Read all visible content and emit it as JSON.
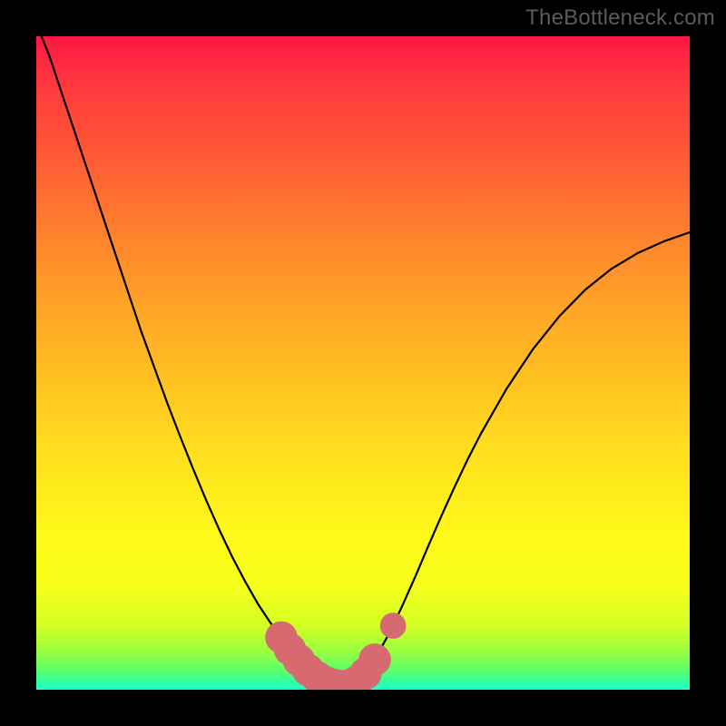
{
  "watermark": "TheBottleneck.com",
  "colors": {
    "curve": "#000000",
    "marker": "#d76a70",
    "marker_stroke": "#d76a70"
  },
  "chart_data": {
    "type": "line",
    "title": "",
    "xlabel": "",
    "ylabel": "",
    "xlim": [
      0,
      100
    ],
    "ylim": [
      0,
      100
    ],
    "grid": false,
    "legend": false,
    "series": [
      {
        "name": "bottleneck-curve",
        "x": [
          0,
          2,
          4,
          6,
          8,
          10,
          12,
          14,
          16,
          18,
          20,
          22,
          24,
          26,
          28,
          30,
          32,
          34,
          36,
          38,
          40,
          42,
          44,
          46,
          47,
          48,
          49,
          50,
          52,
          54,
          56,
          58,
          60,
          62,
          64,
          66,
          68,
          72,
          76,
          80,
          84,
          88,
          92,
          96,
          100
        ],
        "y": [
          102,
          97,
          91,
          85,
          79,
          73,
          67,
          61,
          55,
          49.5,
          44,
          38.8,
          33.8,
          29,
          24.5,
          20.3,
          16.5,
          13,
          10,
          7.4,
          5.2,
          3.4,
          2,
          1,
          0.6,
          0.6,
          1.1,
          2.2,
          5,
          8.6,
          12.8,
          17.3,
          22,
          26.6,
          31,
          35.2,
          39.1,
          46.1,
          52.1,
          57.1,
          61.2,
          64.4,
          66.8,
          68.6,
          70
        ]
      }
    ],
    "marker_cluster": {
      "description": "highlighted segment near curve minimum",
      "points": [
        {
          "x": 37.5,
          "y": 8.0,
          "r": 1.6
        },
        {
          "x": 38.8,
          "y": 6.2,
          "r": 1.6
        },
        {
          "x": 40.2,
          "y": 4.5,
          "r": 1.6
        },
        {
          "x": 41.6,
          "y": 3.0,
          "r": 1.6
        },
        {
          "x": 43.0,
          "y": 1.9,
          "r": 1.6
        },
        {
          "x": 44.4,
          "y": 1.1,
          "r": 1.6
        },
        {
          "x": 45.8,
          "y": 0.7,
          "r": 1.6
        },
        {
          "x": 47.4,
          "y": 0.6,
          "r": 1.6
        },
        {
          "x": 49.0,
          "y": 1.2,
          "r": 1.6
        },
        {
          "x": 50.4,
          "y": 2.5,
          "r": 1.6
        },
        {
          "x": 51.8,
          "y": 4.6,
          "r": 1.6
        },
        {
          "x": 54.6,
          "y": 9.8,
          "r": 1.2
        }
      ]
    }
  }
}
